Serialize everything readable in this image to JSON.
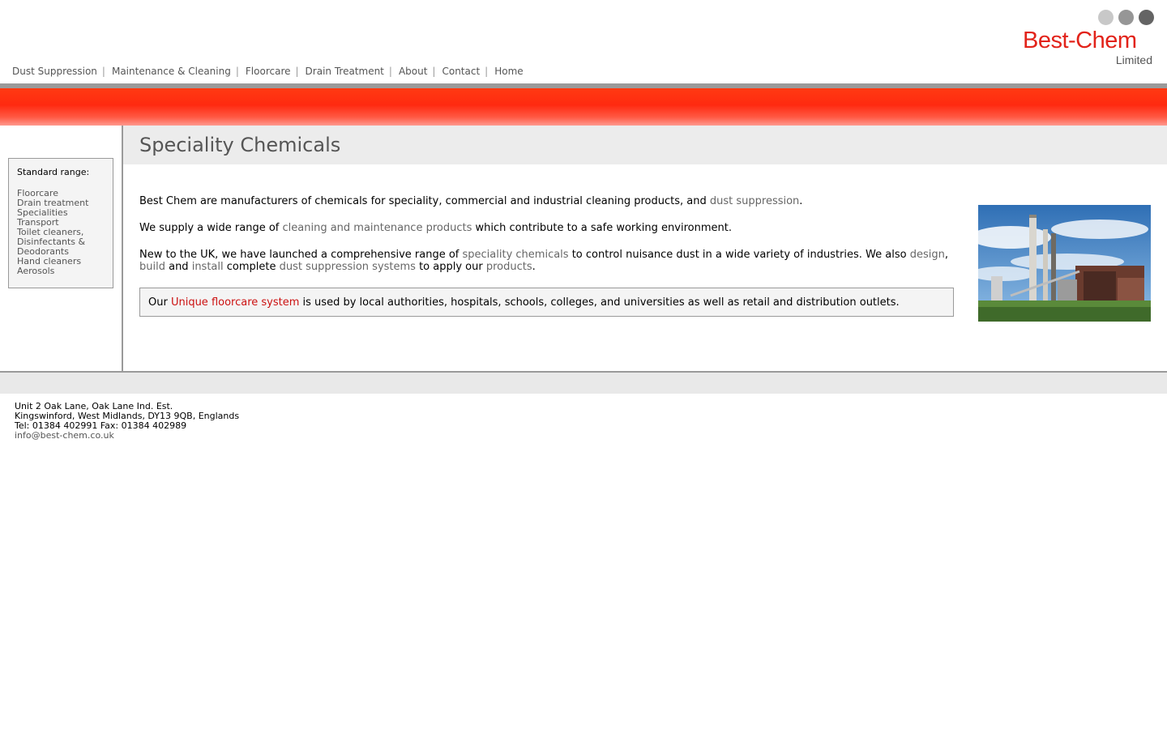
{
  "logo": {
    "brand": "Best-Chem",
    "sub": "Limited",
    "dot_colors": [
      "#c8c8c8",
      "#969696",
      "#646464"
    ],
    "brand_color": "#e2231a"
  },
  "nav": {
    "items": [
      {
        "label": "Dust Suppression"
      },
      {
        "label": "Maintenance & Cleaning"
      },
      {
        "label": "Floorcare"
      },
      {
        "label": "Drain Treatment"
      },
      {
        "label": "About"
      },
      {
        "label": "Contact"
      },
      {
        "label": "Home"
      }
    ],
    "separator": "|"
  },
  "sidebar": {
    "title": "Standard range:",
    "items": [
      "Floorcare",
      "Drain treatment",
      "Specialities",
      "Transport",
      "Toilet cleaners,",
      "Disinfectants &",
      "Deodorants",
      "Hand cleaners",
      "Aerosols"
    ]
  },
  "main": {
    "title": "Speciality Chemicals",
    "p1": {
      "text1": "Best Chem are manufacturers of chemicals for speciality, commercial and industrial cleaning products, and ",
      "link1": "dust suppression",
      "text2": "."
    },
    "p2": {
      "text1": "We supply a wide range of ",
      "link1": "cleaning and maintenance products",
      "text2": " which contribute to a safe working environment."
    },
    "p3": {
      "text1": "New to the UK, we have launched a comprehensive range of ",
      "link1": "speciality chemicals",
      "text2": " to control nuisance dust in a wide variety of industries. We also ",
      "link2": "design",
      "text3": ", ",
      "link3": "build",
      "text4": " and ",
      "link4": "install",
      "text5": " complete ",
      "link5": "dust suppression systems",
      "text6": " to apply our ",
      "link6": "products",
      "text7": "."
    },
    "notice": {
      "text1": "Our ",
      "link": "Unique floorcare system",
      "text2": " is used by local authorities, hospitals, schools, colleges, and universities as well as retail and distribution outlets."
    }
  },
  "footer": {
    "line1": "Unit 2 Oak Lane, Oak Lane Ind. Est.",
    "line2": "Kingswinford, West Midlands, DY13 9QB, Englands",
    "line3": "Tel:  01384 402991  Fax:  01384 402989",
    "email": "info@best-chem.co.uk"
  },
  "colors": {
    "accent_red": "#ff2a10",
    "link_grey": "#666666",
    "notice_link": "#cc1111"
  }
}
